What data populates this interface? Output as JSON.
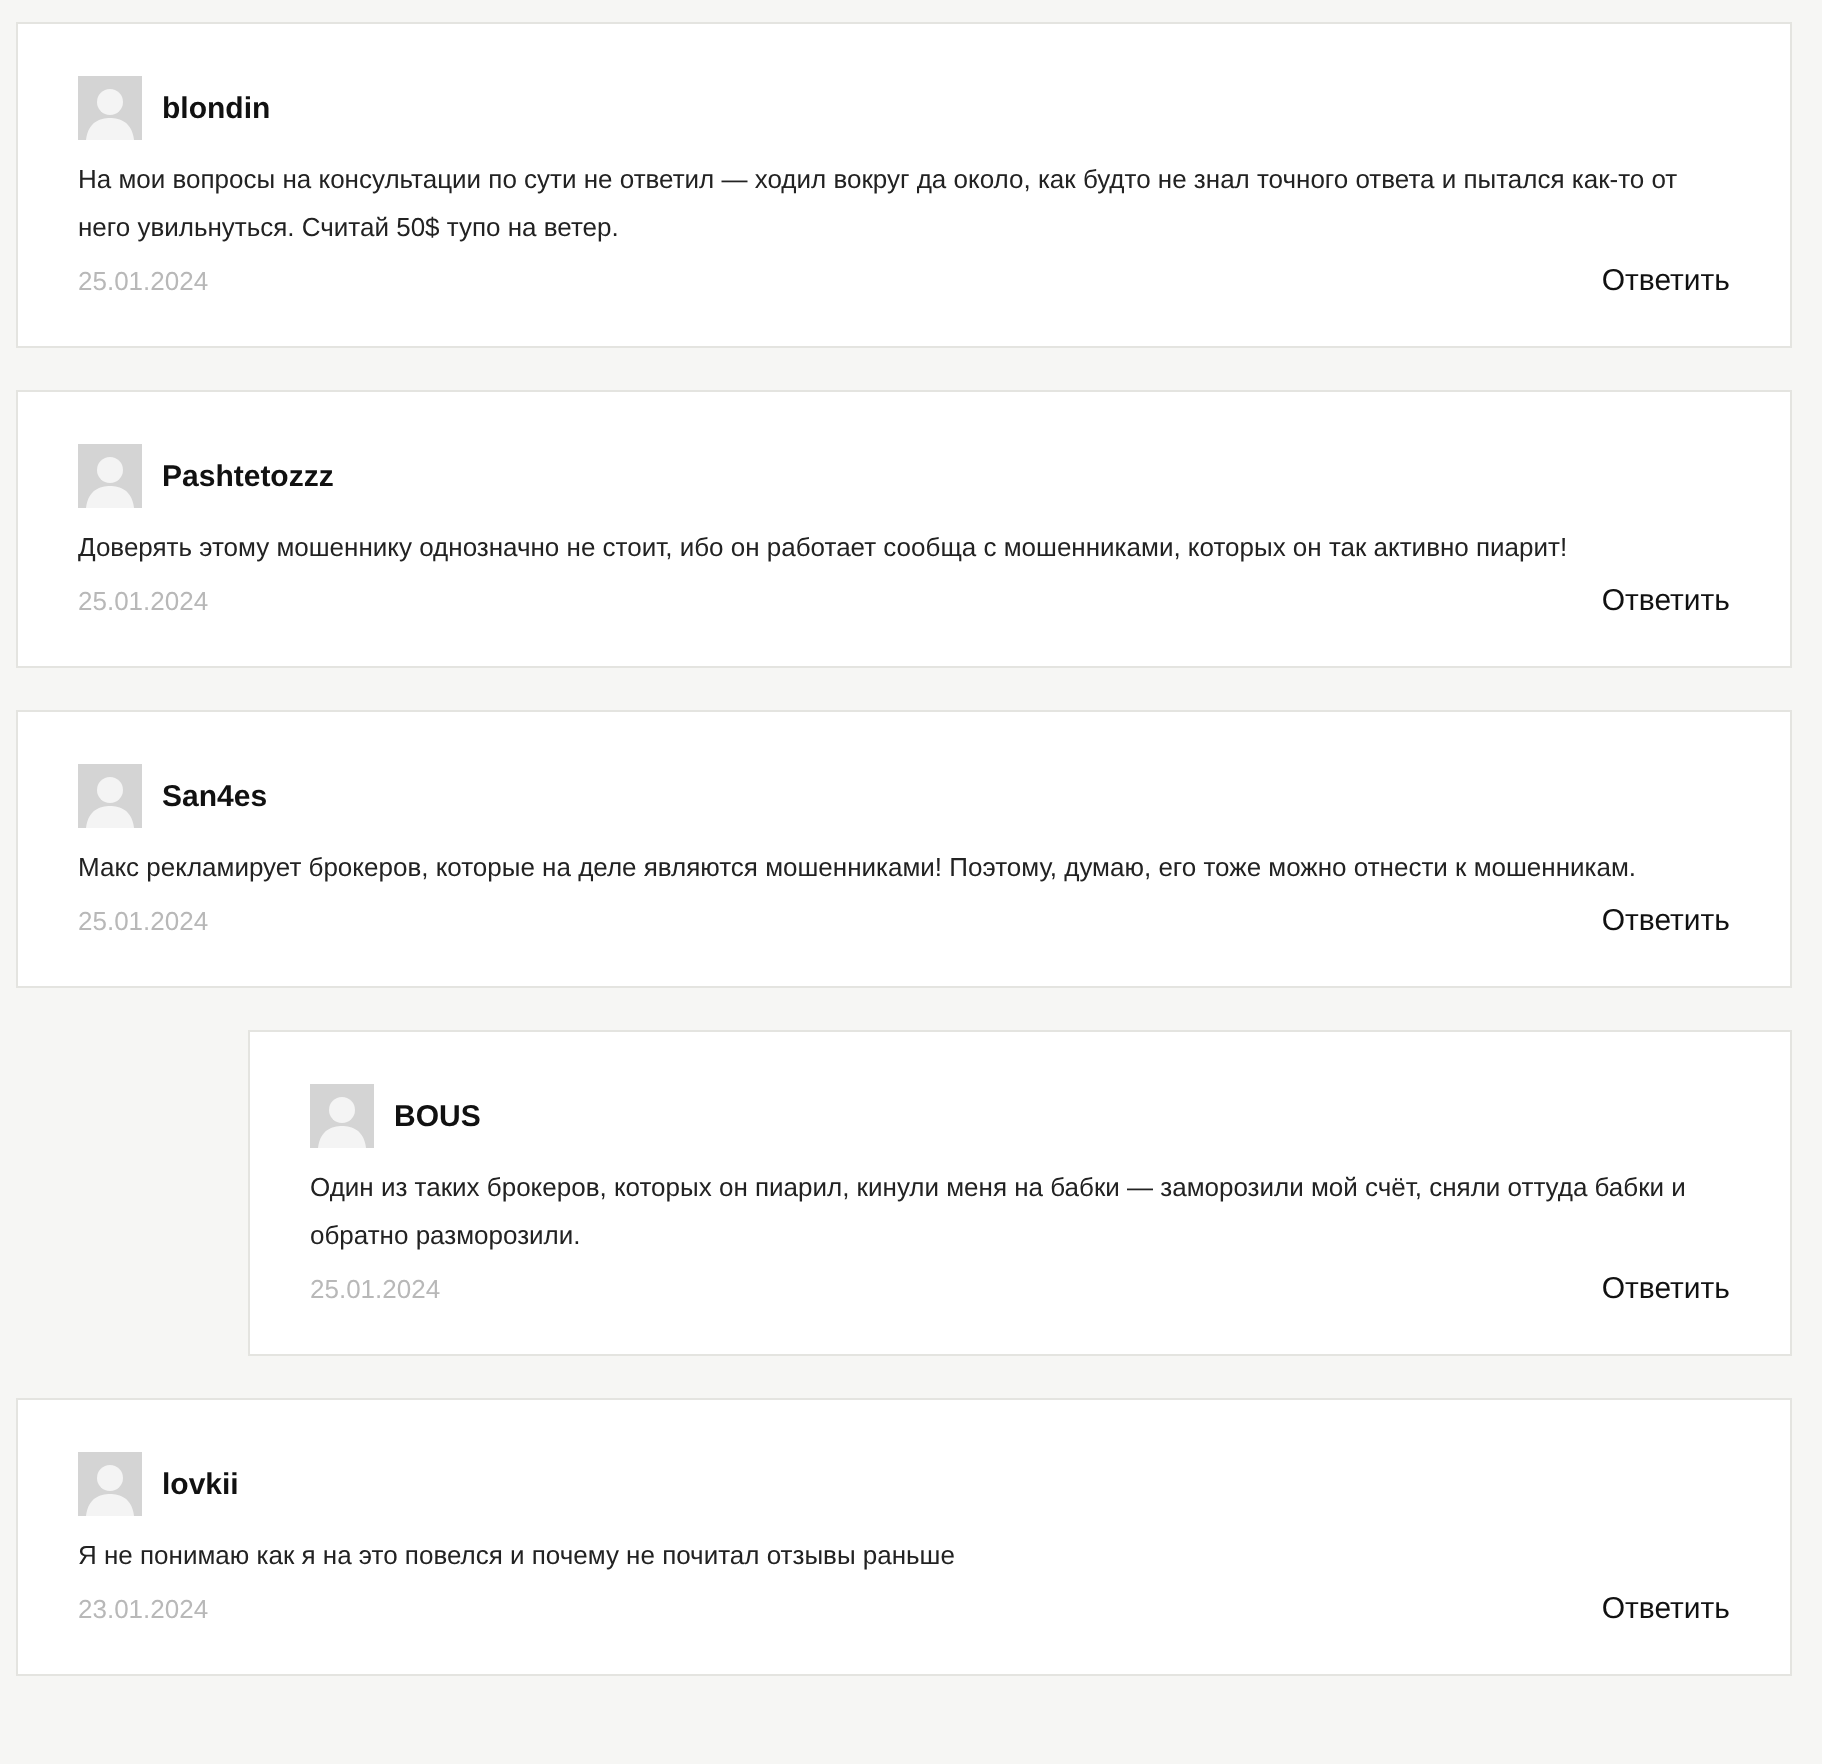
{
  "comments": [
    {
      "author": "blondin",
      "text": "На мои вопросы на консультации по сути не ответил — ходил вокруг да около, как будто не знал точного ответа и пытался как-то от него увильнуться. Считай 50$ тупо на ветер.",
      "date": "25.01.2024",
      "reply": "Ответить"
    },
    {
      "author": "Pashtetozzz",
      "text": "Доверять этому мошеннику однозначно не стоит, ибо он работает сообща с мошенниками, которых он так активно пиарит!",
      "date": "25.01.2024",
      "reply": "Ответить"
    },
    {
      "author": "San4es",
      "text": "Макс рекламирует брокеров, которые на деле являются мошенниками! Поэтому, думаю, его тоже можно отнести к мошенникам.",
      "date": "25.01.2024",
      "reply": "Ответить",
      "children": [
        {
          "author": "BOUS",
          "text": "Один из таких брокеров, которых он пиарил, кинули меня на бабки — заморозили мой счёт, сняли оттуда бабки и обратно разморозили.",
          "date": "25.01.2024",
          "reply": "Ответить"
        }
      ]
    },
    {
      "author": "lovkii",
      "text": "Я не понимаю как я на это повелся и почему не почитал отзывы раньше",
      "date": "23.01.2024",
      "reply": "Ответить"
    }
  ]
}
